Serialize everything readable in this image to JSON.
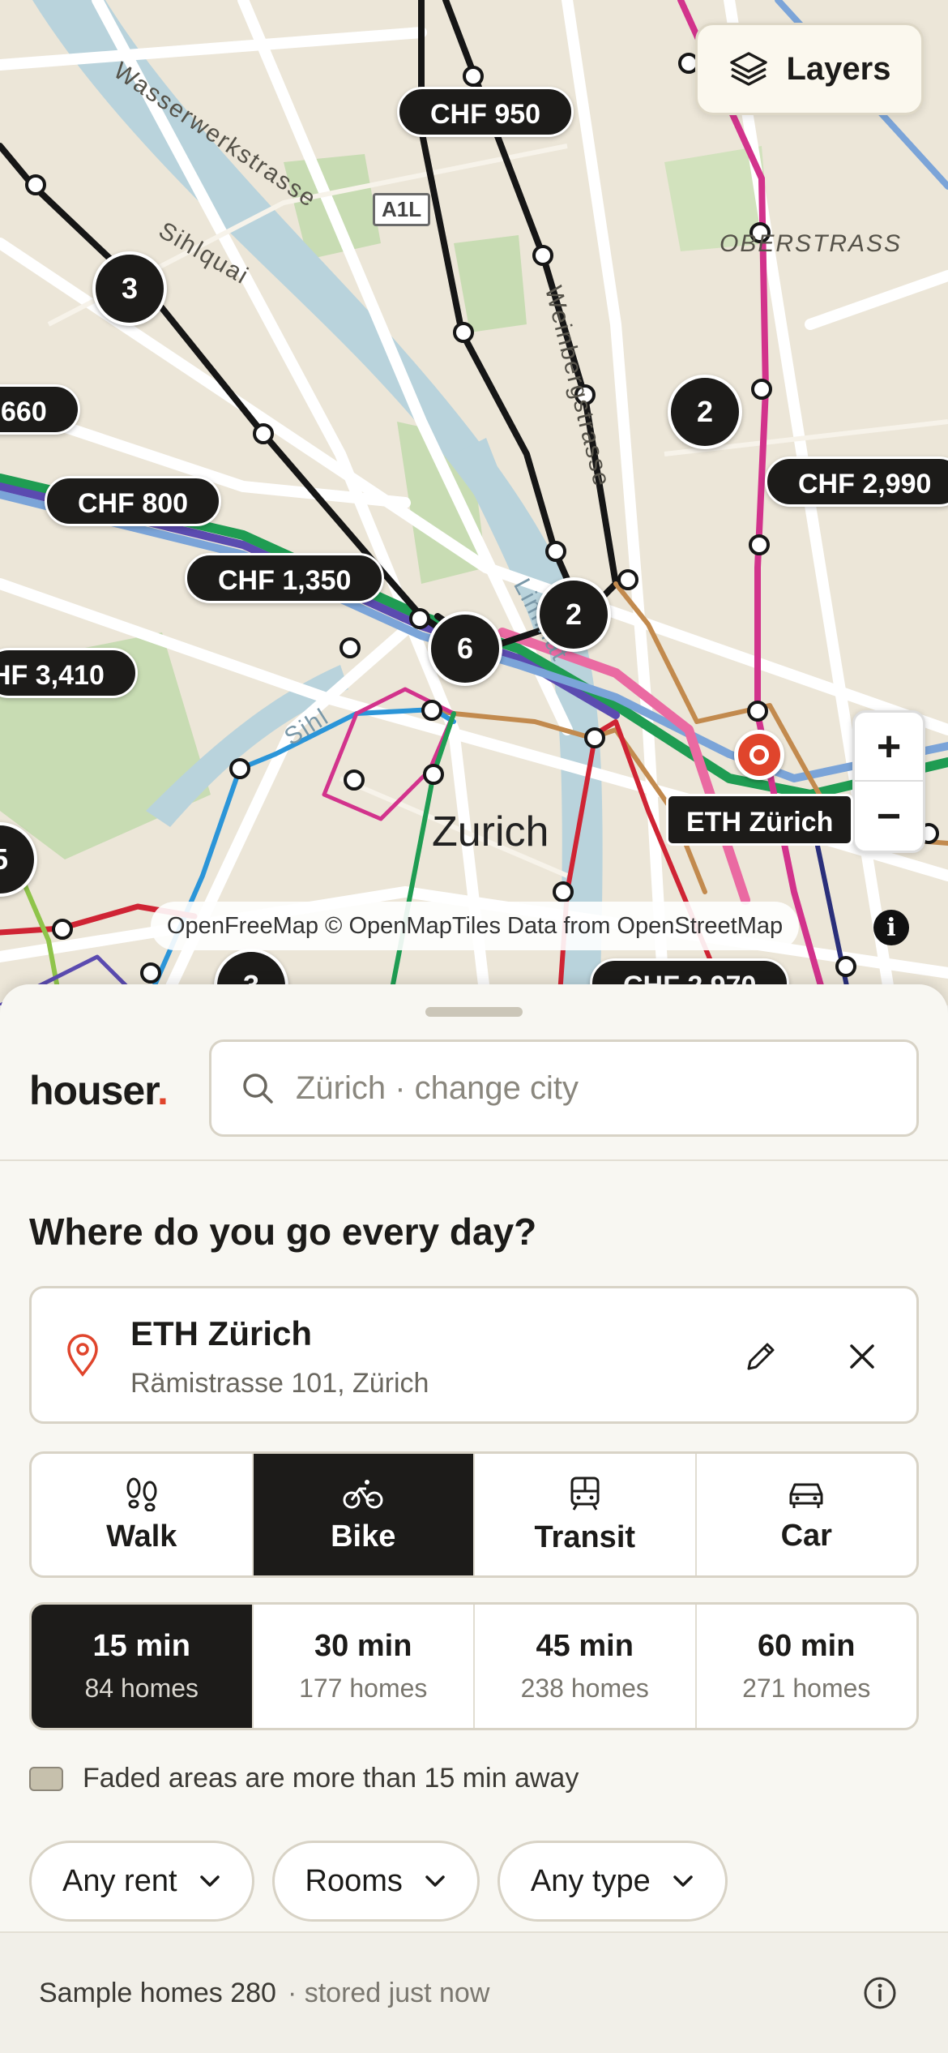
{
  "map": {
    "layers_label": "Layers",
    "city_label": "Zurich",
    "destination_label": "ETH Zürich",
    "attribution": "OpenFreeMap © OpenMapTiles Data from OpenStreetMap",
    "street_labels": [
      "Wasserwerkstrasse",
      "Sihlquai",
      "Weinbergstrasse",
      "OBERSTRASS",
      "Limmat",
      "Sihl"
    ],
    "road_shield": "A1L",
    "price_pins": [
      "CHF 950",
      "660",
      "CHF 800",
      "CHF 1,350",
      "CHF 2,990",
      "HF 3,410",
      "CHF 2,970"
    ],
    "clusters": [
      "3",
      "2",
      "2",
      "6",
      "5",
      "3"
    ],
    "zoom_in": "+",
    "zoom_out": "−",
    "info_glyph": "i",
    "colors": {
      "magenta_route": "#d2338c",
      "black_route": "#161616",
      "brown_route": "#c28a4e",
      "blue_route": "#2b95d8",
      "green_route": "#1f9c52",
      "red_route": "#cf2434",
      "water": "#b9d3dc",
      "park": "#c8dcb3"
    }
  },
  "sheet": {
    "logo_text": "houser",
    "logo_dot": ".",
    "search_placeholder": "Zürich · change city",
    "question": "Where do you go every day?",
    "destination": {
      "name": "ETH Zürich",
      "address": "Rämistrasse 101, Zürich"
    },
    "modes": [
      {
        "label": "Walk",
        "icon": "footprints-icon",
        "active": false
      },
      {
        "label": "Bike",
        "icon": "bike-icon",
        "active": true
      },
      {
        "label": "Transit",
        "icon": "tram-icon",
        "active": false
      },
      {
        "label": "Car",
        "icon": "car-icon",
        "active": false
      }
    ],
    "times": [
      {
        "time": "15 min",
        "homes": "84 homes",
        "active": true
      },
      {
        "time": "30 min",
        "homes": "177 homes",
        "active": false
      },
      {
        "time": "45 min",
        "homes": "238 homes",
        "active": false
      },
      {
        "time": "60 min",
        "homes": "271 homes",
        "active": false
      }
    ],
    "faded_note": "Faded areas are more than 15 min away",
    "filters": [
      "Any rent",
      "Rooms",
      "Any type"
    ],
    "footer": {
      "sample_text": "Sample homes 280",
      "stored_text": "· stored just now"
    },
    "accent_color": "#e0452c"
  }
}
